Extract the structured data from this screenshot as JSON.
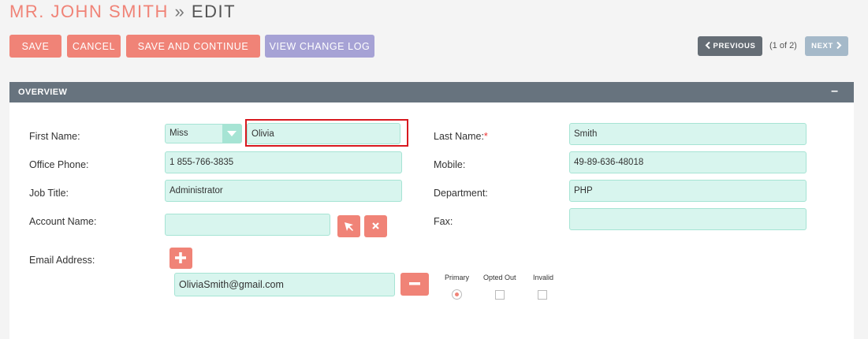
{
  "header": {
    "record_name": "MR. JOHN SMITH",
    "separator": "»",
    "mode": "EDIT"
  },
  "toolbar": {
    "save": "SAVE",
    "cancel": "CANCEL",
    "save_continue": "SAVE AND CONTINUE",
    "view_log": "VIEW CHANGE LOG"
  },
  "pagination": {
    "previous": "PREVIOUS",
    "position": "(1 of 2)",
    "next": "NEXT"
  },
  "panel": {
    "title": "OVERVIEW",
    "collapse_symbol": "–"
  },
  "labels": {
    "first_name": "First Name:",
    "last_name": "Last Name:",
    "required_mark": "*",
    "office_phone": "Office Phone:",
    "mobile": "Mobile:",
    "job_title": "Job Title:",
    "department": "Department:",
    "account_name": "Account Name:",
    "fax": "Fax:",
    "email_address": "Email Address:"
  },
  "fields": {
    "salutation": "Miss",
    "first_name": "Olivia",
    "last_name": "Smith",
    "office_phone": "1 855-766-3835",
    "mobile": "49-89-636-48018",
    "job_title": "Administrator",
    "department": "PHP",
    "account_name": "",
    "fax": "",
    "email": "OliviaSmith@gmail.com"
  },
  "email_options": {
    "primary": "Primary",
    "opted_out": "Opted Out",
    "invalid": "Invalid"
  },
  "icons": {
    "select": "arrow-cursor-icon",
    "clear": "x-icon",
    "add": "plus-icon",
    "remove": "minus-icon",
    "prev": "chevron-left-icon",
    "next": "chevron-right-icon"
  },
  "colors": {
    "accent": "#f08377",
    "purple": "#a6a2d5",
    "panel_header": "#67737e",
    "field_bg": "#d8f5ee",
    "highlight": "#d8191f"
  }
}
